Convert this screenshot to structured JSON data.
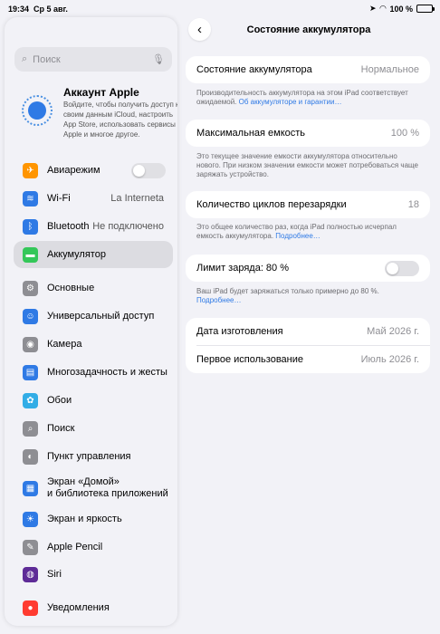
{
  "status": {
    "time": "19:34",
    "date": "Ср 5 авг.",
    "battery": "100 %"
  },
  "sidebar": {
    "search_placeholder": "Поиск",
    "account": {
      "name": "Аккаунт Apple",
      "description": "Войдите, чтобы получить доступ к своим данным iCloud, настроить App Store, использовать сервисы Apple и многое другое."
    },
    "items": [
      {
        "label": "Авиарежим",
        "icon": "airplane-icon",
        "color": "#ff9500",
        "glyph": "✈",
        "toggle": true
      },
      {
        "label": "Wi-Fi",
        "icon": "wifi-icon",
        "color": "#2f7ae5",
        "glyph": "≋",
        "value": "La Interneta"
      },
      {
        "label": "Bluetooth",
        "icon": "bluetooth-icon",
        "color": "#2f7ae5",
        "glyph": "ᛒ",
        "value": "Не подключено"
      },
      {
        "label": "Аккумулятор",
        "icon": "battery-icon",
        "color": "#34c759",
        "glyph": "▬",
        "active": true
      },
      {
        "label": "Основные",
        "icon": "gear-icon",
        "color": "#8e8e93",
        "glyph": "⚙"
      },
      {
        "label": "Универсальный доступ",
        "icon": "accessibility-icon",
        "color": "#2f7ae5",
        "glyph": "☺"
      },
      {
        "label": "Камера",
        "icon": "camera-icon",
        "color": "#8e8e93",
        "glyph": "◉"
      },
      {
        "label": "Многозадачность и жесты",
        "icon": "multitasking-icon",
        "color": "#2f7ae5",
        "glyph": "▤"
      },
      {
        "label": "Обои",
        "icon": "wallpaper-icon",
        "color": "#32ade6",
        "glyph": "✿"
      },
      {
        "label": "Поиск",
        "icon": "search-icon",
        "color": "#8e8e93",
        "glyph": "⌕"
      },
      {
        "label": "Пункт управления",
        "icon": "control-center-icon",
        "color": "#8e8e93",
        "glyph": "◐"
      },
      {
        "label": "Экран «Домой»\nи библиотека приложений",
        "icon": "home-screen-icon",
        "color": "#2f7ae5",
        "glyph": "▦"
      },
      {
        "label": "Экран и яркость",
        "icon": "brightness-icon",
        "color": "#2f7ae5",
        "glyph": "☀"
      },
      {
        "label": "Apple Pencil",
        "icon": "pencil-icon",
        "color": "#8e8e93",
        "glyph": "✎"
      },
      {
        "label": "Siri",
        "icon": "siri-icon",
        "color": "#5e2b97",
        "glyph": "◍"
      },
      {
        "label": "Уведомления",
        "icon": "notifications-icon",
        "color": "#ff3b30",
        "glyph": "●"
      }
    ]
  },
  "main": {
    "title": "Состояние аккумулятора",
    "health": {
      "label": "Состояние аккумулятора",
      "value": "Нормальное"
    },
    "health_note": "Производительность аккумулятора на этом iPad соответствует ожидаемой.",
    "health_link": "Об аккумуляторе и гарантии…",
    "capacity": {
      "label": "Максимальная емкость",
      "value": "100 %"
    },
    "capacity_note": "Это текущее значение емкости аккумулятора относительно нового. При низком значении емкости может потребоваться чаще заряжать устройство.",
    "cycles": {
      "label": "Количество циклов перезарядки",
      "value": "18"
    },
    "cycles_note": "Это общее количество раз, когда iPad полностью исчерпал емкость аккумулятора.",
    "cycles_link": "Подробнее…",
    "limit": {
      "label": "Лимит заряда: 80 %"
    },
    "limit_note": "Ваш iPad будет заряжаться только примерно до 80 %.",
    "limit_link": "Подробнее…",
    "manufacture": {
      "label": "Дата изготовления",
      "value": "Май 2026 г."
    },
    "first_use": {
      "label": "Первое использование",
      "value": "Июль 2026 г."
    }
  }
}
